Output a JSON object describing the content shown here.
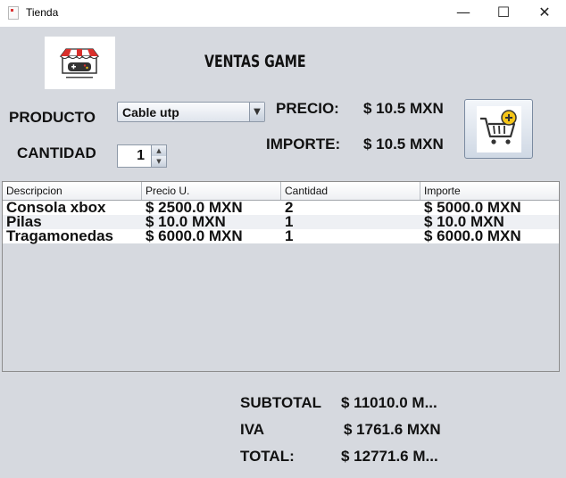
{
  "window": {
    "title": "Tienda",
    "minimize_glyph": "—",
    "maximize_glyph": "☐",
    "close_glyph": "✕"
  },
  "header": {
    "title": "VENTAS GAME"
  },
  "form": {
    "producto_label": "PRODUCTO",
    "producto_value": "Cable utp",
    "cantidad_label": "CANTIDAD",
    "cantidad_value": "1",
    "precio_label": "PRECIO:",
    "precio_value": "$ 10.5 MXN",
    "importe_label": "IMPORTE:",
    "importe_value": "$ 10.5 MXN"
  },
  "table": {
    "columns": [
      "Descripcion",
      "Precio U.",
      "Cantidad",
      "Importe"
    ],
    "rows": [
      [
        "Consola xbox",
        "$ 2500.0 MXN",
        "2",
        "$ 5000.0 MXN"
      ],
      [
        "Pilas",
        "$ 10.0 MXN",
        "1",
        "$ 10.0 MXN"
      ],
      [
        "Tragamonedas",
        "$ 6000.0 MXN",
        "1",
        "$ 6000.0 MXN"
      ]
    ]
  },
  "totals": {
    "subtotal_label": "SUBTOTAL",
    "subtotal_value": "$ 11010.0 M...",
    "iva_label": "IVA",
    "iva_value": "$ 1761.6 MXN",
    "total_label": "TOTAL:",
    "total_value": "$ 12771.6 M..."
  },
  "icons": {
    "logo": "store-gamepad-logo-icon",
    "cart": "add-to-cart-icon",
    "combo_arrow": "chevron-down-icon"
  },
  "colors": {
    "background": "#d6d9df",
    "logo_red": "#d9302c",
    "cart_plus": "#f5c518"
  }
}
